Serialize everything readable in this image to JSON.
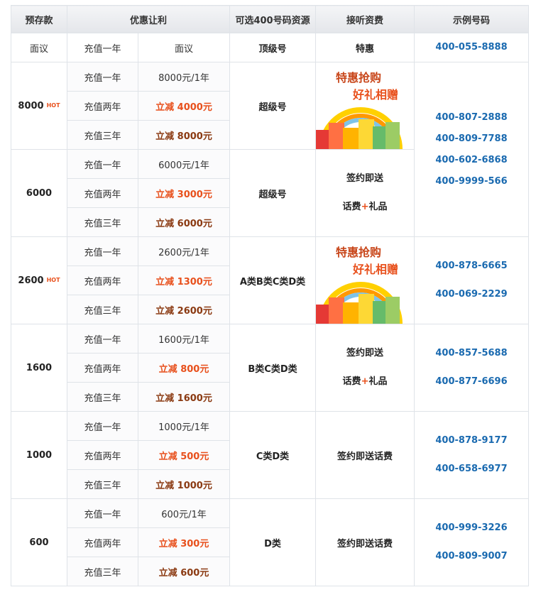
{
  "headers": [
    "预存款",
    "优惠让利",
    "可选400号码资源",
    "接听资费",
    "示例号码"
  ],
  "top_row": {
    "deposit": "面议",
    "period": "充值一年",
    "value": "面议",
    "type": "顶级号",
    "fee": "特惠",
    "number": "400-055-8888"
  },
  "hot_label": "HOT",
  "periods": [
    "充值一年",
    "充值两年",
    "充值三年"
  ],
  "promo": {
    "line1": "特惠抢购",
    "line2": "好礼相赠"
  },
  "fee_gift": {
    "line1": "签约即送",
    "line2a": "话费",
    "plus": "+",
    "line2b": "礼品"
  },
  "fee_simple": "签约即送话费",
  "tiers": [
    {
      "amount": "8000",
      "hot": true,
      "values": [
        "8000元/1年",
        "立减 4000元",
        "立减 8000元"
      ],
      "type": "超级号"
    },
    {
      "amount": "6000",
      "hot": false,
      "values": [
        "6000元/1年",
        "立减 3000元",
        "立减 6000元"
      ],
      "type": "超级号"
    },
    {
      "amount": "2600",
      "hot": true,
      "values": [
        "2600元/1年",
        "立减 1300元",
        "立减 2600元"
      ],
      "type": "A类B类C类D类"
    },
    {
      "amount": "1600",
      "hot": false,
      "values": [
        "1600元/1年",
        "立减 800元",
        "立减 1600元"
      ],
      "type": "B类C类D类"
    },
    {
      "amount": "1000",
      "hot": false,
      "values": [
        "1000元/1年",
        "立减 500元",
        "立减 1000元"
      ],
      "type": "C类D类"
    },
    {
      "amount": "600",
      "hot": false,
      "values": [
        "600元/1年",
        "立减 300元",
        "立减 600元"
      ],
      "type": "D类"
    }
  ],
  "numbers": {
    "group1": [
      "400-807-2888",
      "400-809-7788",
      "400-602-6868",
      "400-9999-566"
    ],
    "group2": [
      "400-878-6665",
      "400-069-2229"
    ],
    "group3": [
      "400-857-5688",
      "400-877-6696"
    ],
    "group4": [
      "400-878-9177",
      "400-658-6977"
    ],
    "group5": [
      "400-999-3226",
      "400-809-9007"
    ]
  }
}
